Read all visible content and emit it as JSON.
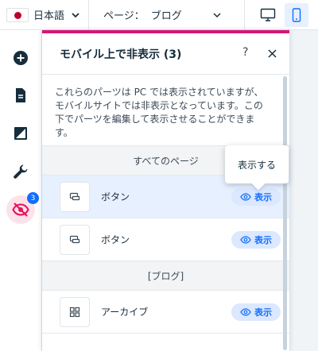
{
  "topbar": {
    "language": "日本語",
    "page_prefix": "ページ：",
    "page_value": "ブログ"
  },
  "rail": {
    "hidden_count": "3"
  },
  "panel": {
    "title": "モバイル上で非表示 (3)",
    "help": "?",
    "description": "これらのパーツは PC では表示されていますが、モバイルサイトでは非表示となっています。この下でパーツを編集して表示させることができます。",
    "sections": [
      {
        "heading": "すべてのページ",
        "items": [
          {
            "label": "ボタン",
            "action": "表示"
          },
          {
            "label": "ボタン",
            "action": "表示"
          }
        ]
      },
      {
        "heading": "[ブログ]",
        "items": [
          {
            "label": "アーカイブ",
            "action": "表示"
          }
        ]
      }
    ]
  },
  "tooltip": "表示する",
  "colors": {
    "accent": "#116dff",
    "panel_border": "#d6167a",
    "hidden_active": "#e8125c"
  }
}
